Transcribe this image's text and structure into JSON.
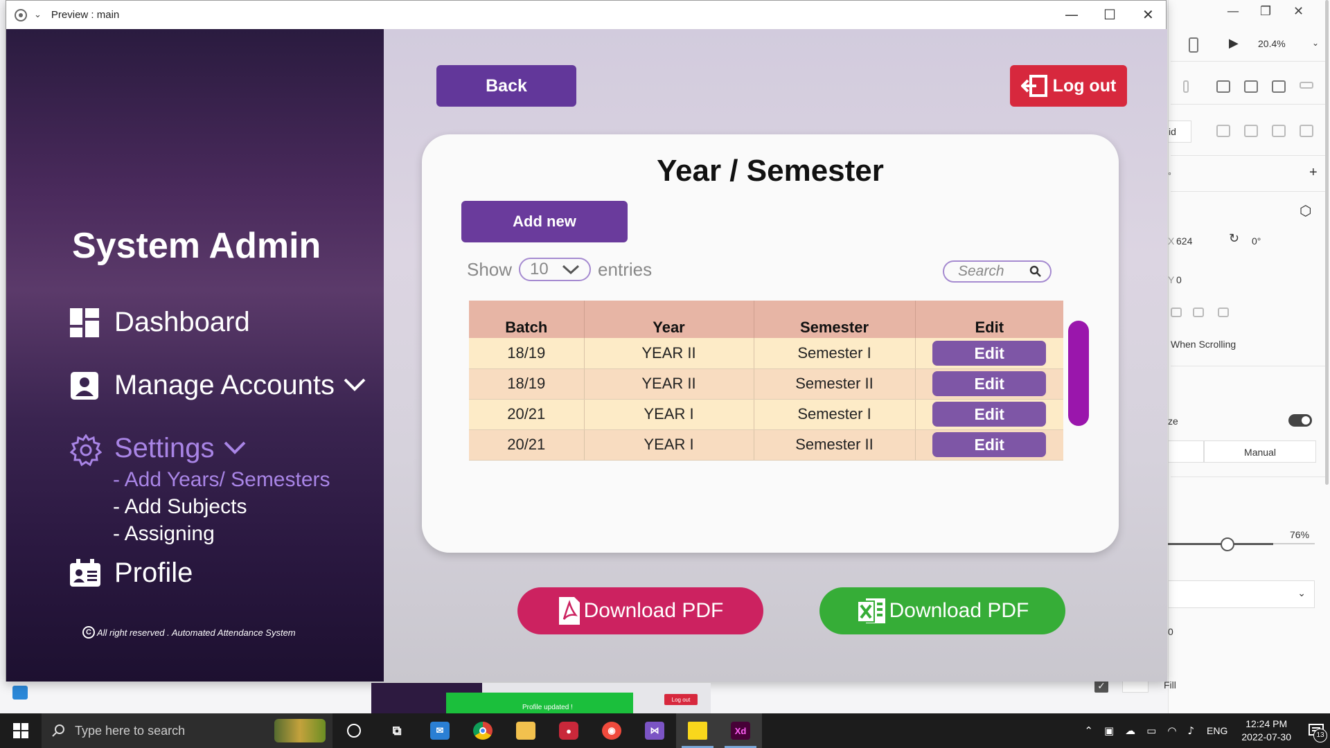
{
  "window": {
    "title": "Preview : main"
  },
  "xd_panel": {
    "zoom": "20.4%",
    "x_label": "X",
    "x_value": "624",
    "rotation": "0°",
    "y_label": "Y",
    "y_value": "0",
    "grid_label": "id",
    "scrolling_label": "When Scrolling",
    "resize_label": "ze",
    "manual_label": "Manual",
    "opacity_value": "76%",
    "zero_label": "0",
    "fill_label": "Fill"
  },
  "sidebar": {
    "title": "System Admin",
    "nav": [
      {
        "label": "Dashboard",
        "icon": "dashboard-icon"
      },
      {
        "label": "Manage Accounts",
        "icon": "account-icon"
      },
      {
        "label": "Settings",
        "icon": "gear-icon"
      },
      {
        "label": "Profile",
        "icon": "id-card-icon"
      }
    ],
    "settings_sub": [
      "- Add Years/ Semesters",
      "- Add Subjects",
      "- Assigning"
    ],
    "footer": "All right reserved . Automated Attendance System"
  },
  "main": {
    "back_label": "Back",
    "logout_label": "Log out",
    "card_title": "Year / Semester",
    "add_new_label": "Add new",
    "show_label": "Show",
    "entries_value": "10",
    "entries_label": "entries",
    "search_placeholder": "Search",
    "table": {
      "headers": [
        "Batch",
        "Year",
        "Semester",
        "Edit"
      ],
      "rows": [
        {
          "batch": "18/19",
          "year": "YEAR II",
          "semester": "Semester I",
          "edit": "Edit"
        },
        {
          "batch": "18/19",
          "year": "YEAR II",
          "semester": "Semester II",
          "edit": "Edit"
        },
        {
          "batch": "20/21",
          "year": "YEAR I",
          "semester": "Semester I",
          "edit": "Edit"
        },
        {
          "batch": "20/21",
          "year": "YEAR I",
          "semester": "Semester II",
          "edit": "Edit"
        }
      ]
    },
    "download_pdf_label": "Download PDF",
    "download_excel_label": "Download PDF"
  },
  "thumbnail": {
    "toast_text": "Profile updated !",
    "logout_text": "Log out"
  },
  "taskbar": {
    "search_placeholder": "Type here to search",
    "apps": [
      "cortana-icon",
      "task-view-icon",
      "mail-icon",
      "chrome-icon",
      "file-explorer-icon",
      "screen-recorder-icon",
      "camera-app-icon",
      "visual-studio-icon",
      "sticky-notes-icon",
      "adobe-xd-icon"
    ],
    "language": "ENG",
    "time": "12:24 PM",
    "date": "2022-07-30",
    "notification_count": "13"
  },
  "colors": {
    "primary_purple": "#62379a",
    "logout_red": "#d7283d",
    "pdf_pink": "#cc2260",
    "excel_green": "#36ad37",
    "active_nav": "#a985e6",
    "table_header": "#e7b5a5"
  }
}
